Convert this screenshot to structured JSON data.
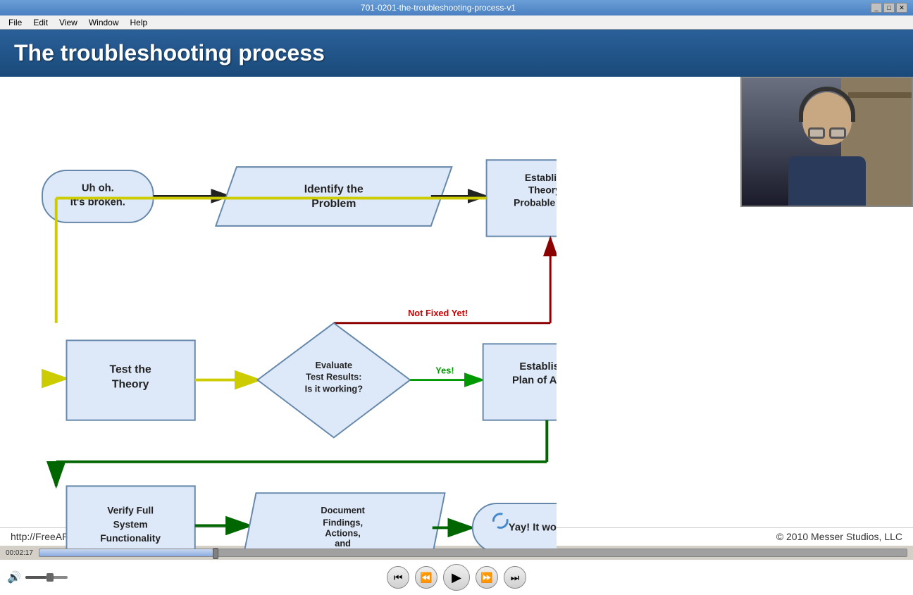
{
  "window": {
    "title": "701-0201-the-troubleshooting-process-v1",
    "menu": [
      "File",
      "Edit",
      "View",
      "Window",
      "Help"
    ]
  },
  "slide": {
    "title": "The troubleshooting process",
    "nodes": {
      "broken": "Uh oh.\nIt's broken.",
      "identify": "Identify the\nProblem",
      "theory": "Establish a\nTheory of\nProbable Cause",
      "test": "Test the\nTheory",
      "evaluate": "Evaluate\nTest Results:\nIs it working?",
      "plan": "Establish a\nPlan of Action",
      "verify": "Verify Full\nSystem\nFunctionality",
      "document": "Document\nFindings,\nActions,\nand\nOutcomes",
      "yay": "Yay! It works!",
      "notFixed": "Not Fixed Yet!"
    },
    "bottom_url": "http://FreeAPlus.com",
    "bottom_copyright": "© 2010 Messer Studios, LLC"
  },
  "player": {
    "time": "00:02:17",
    "progress": 20
  },
  "controls": {
    "skip_back_label": "⏮",
    "rewind_label": "⏪",
    "play_label": "▶",
    "forward_label": "⏩",
    "skip_forward_label": "⏭"
  }
}
